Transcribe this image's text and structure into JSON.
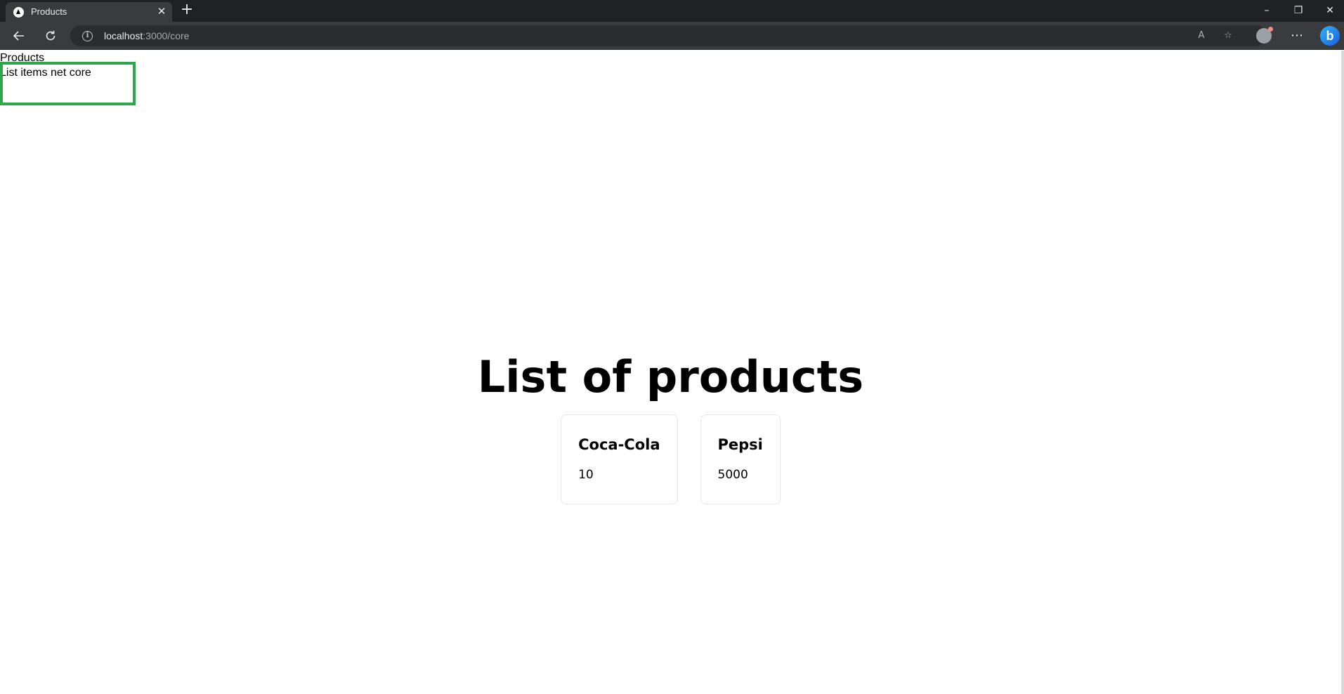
{
  "browser": {
    "tab_title": "Products",
    "tab_close": "✕",
    "new_tab": "+",
    "url_host": "localhost",
    "url_rest": ":3000/core",
    "window_controls": {
      "minimize": "–",
      "restore": "❐",
      "close": "✕"
    },
    "icons": {
      "back": "arrow-left-icon",
      "reload": "reload-icon",
      "info": "info-icon",
      "read_aloud": "read-aloud-icon",
      "favorites": "favorites-add-icon",
      "profile": "profile-avatar-icon",
      "more": "more-icon",
      "bing": "bing-icon"
    }
  },
  "page": {
    "nav": [
      {
        "label": "Products"
      },
      {
        "label": "List items net core"
      }
    ],
    "heading": "List of products",
    "products": [
      {
        "name": "Coca-Cola",
        "price": "10"
      },
      {
        "name": "Pepsi",
        "price": "5000"
      }
    ],
    "highlight_color": "#2ba84a"
  }
}
